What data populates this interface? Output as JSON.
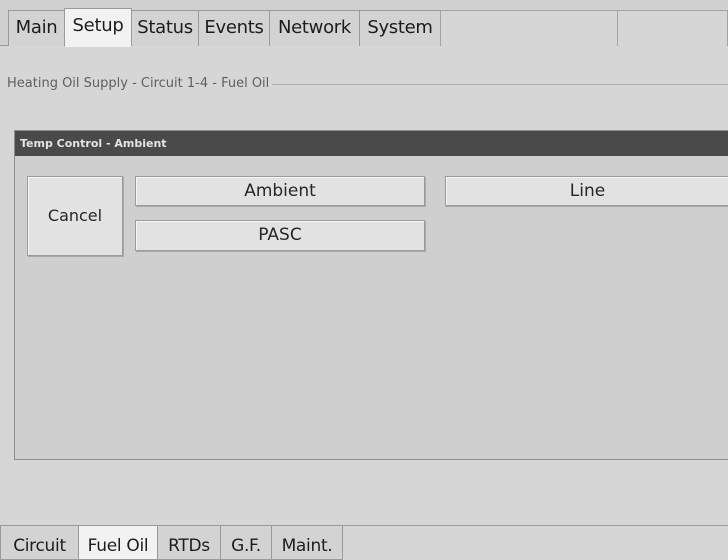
{
  "top_tabs": [
    {
      "label": "Main",
      "active": false
    },
    {
      "label": "Setup",
      "active": true
    },
    {
      "label": "Status",
      "active": false
    },
    {
      "label": "Events",
      "active": false
    },
    {
      "label": "Network",
      "active": false
    },
    {
      "label": "System",
      "active": false
    }
  ],
  "breadcrumb": "Heating Oil Supply - Circuit 1-4 - Fuel Oil",
  "dialog": {
    "title": "Temp Control - Ambient",
    "cancel_label": "Cancel",
    "options": {
      "ambient": "Ambient",
      "pasc": "PASC",
      "line": "Line"
    }
  },
  "bottom_tabs": [
    {
      "label": "Circuit",
      "active": false
    },
    {
      "label": "Fuel Oil",
      "active": true
    },
    {
      "label": "RTDs",
      "active": false
    },
    {
      "label": "G.F.",
      "active": false
    },
    {
      "label": "Maint.",
      "active": false
    }
  ],
  "colors": {
    "background": "#d6d6d6",
    "dialog_title_bar": "#4a4a4a",
    "active_tab": "#f2f2f2"
  }
}
